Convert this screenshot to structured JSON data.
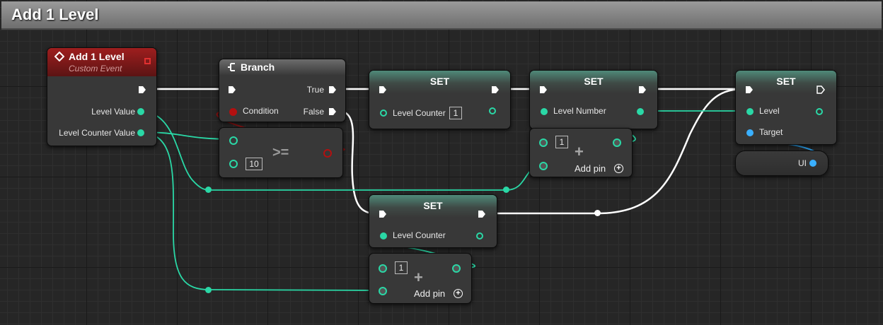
{
  "window": {
    "title": "Add 1 Level"
  },
  "colors": {
    "event_header": "#8e1b1b",
    "exec_wire": "#ffffff",
    "integer_wire": "#2ad8a6",
    "boolean_wire": "#8a1010",
    "object_wire": "#2a9de8"
  },
  "event_node": {
    "title": "Add 1 Level",
    "subtitle": "Custom Event",
    "outputs": [
      "Level Value",
      "Level Counter Value"
    ]
  },
  "branch_node": {
    "title": "Branch",
    "condition_label": "Condition",
    "true_label": "True",
    "false_label": "False"
  },
  "compare_node": {
    "operator": ">=",
    "value": "10"
  },
  "set_counter_true": {
    "title": "SET",
    "variable": "Level Counter",
    "value": "1"
  },
  "set_level_number": {
    "title": "SET",
    "variable": "Level Number"
  },
  "add_node_top": {
    "value": "1",
    "add_pin_label": "Add pin"
  },
  "set_level_widget": {
    "title": "SET",
    "variable": "Level",
    "target_label": "Target"
  },
  "ui_getter": {
    "label": "UI"
  },
  "set_counter_false": {
    "title": "SET",
    "variable": "Level Counter"
  },
  "add_node_bottom": {
    "value": "1",
    "add_pin_label": "Add pin"
  }
}
